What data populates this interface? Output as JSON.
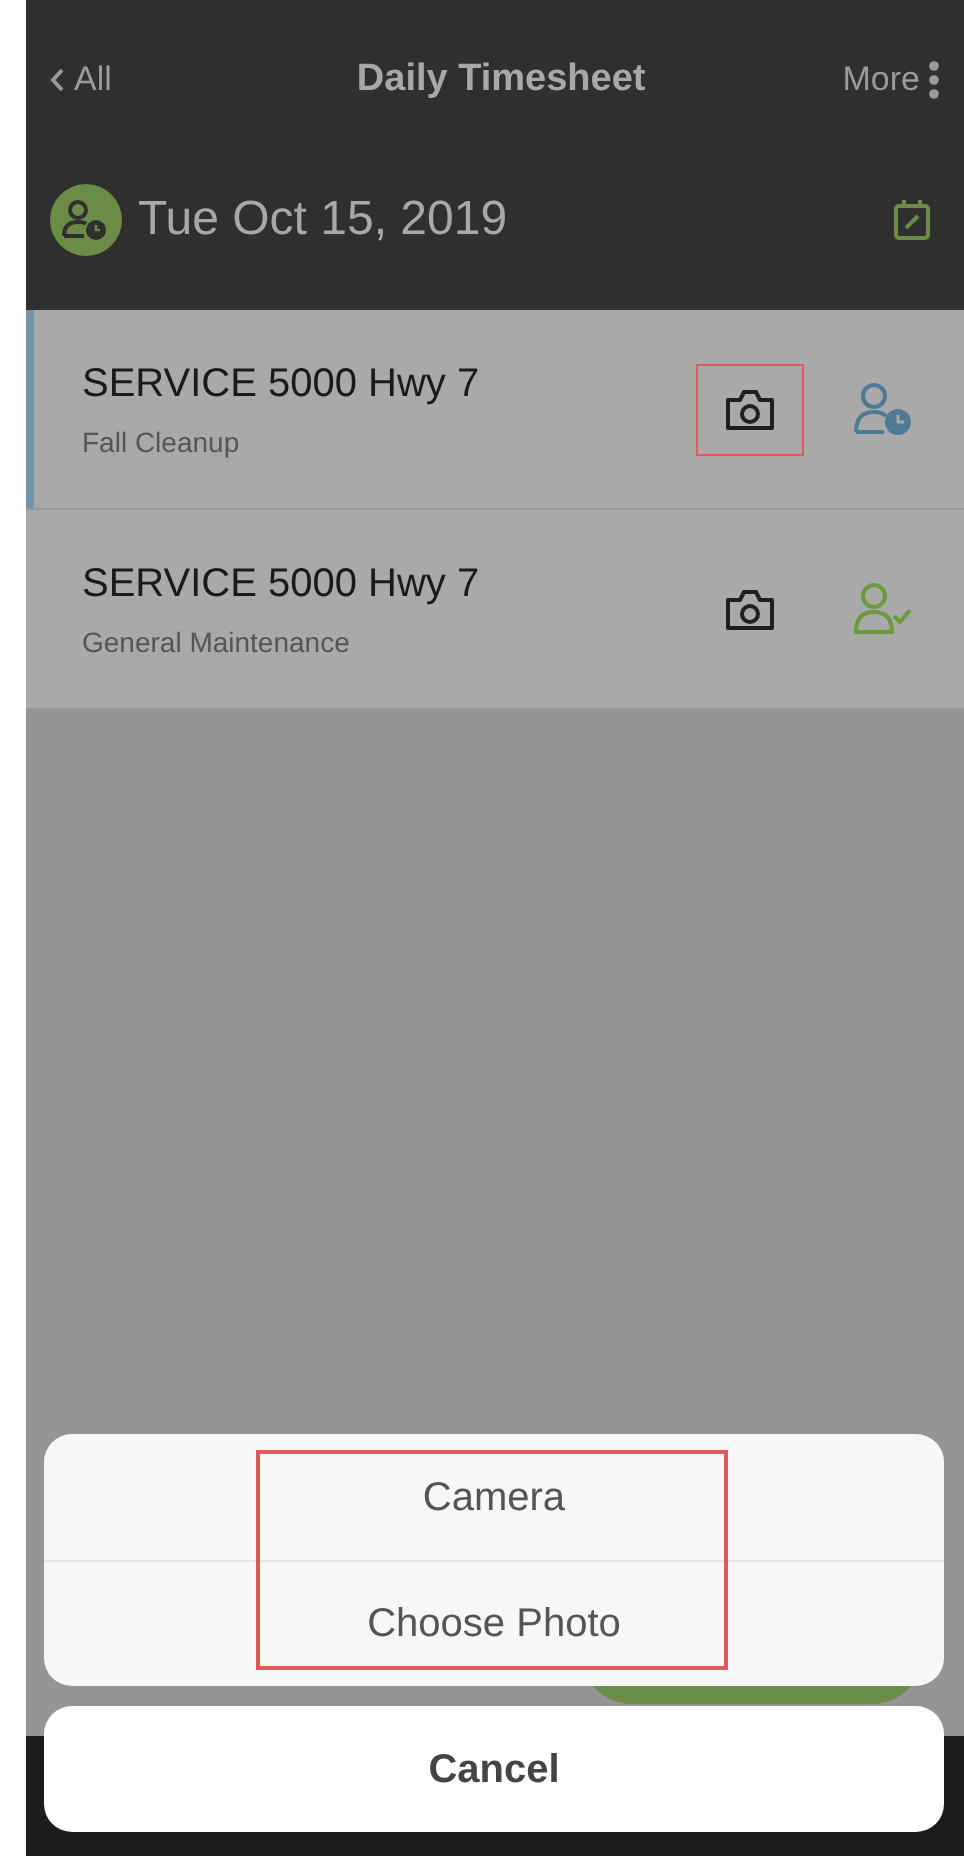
{
  "nav": {
    "back": "All",
    "title": "Daily Timesheet",
    "more": "More"
  },
  "date_bar": {
    "date": "Tue Oct 15, 2019"
  },
  "rows": [
    {
      "title": "SERVICE 5000 Hwy 7",
      "subtitle": "Fall Cleanup",
      "selected": true,
      "camera_highlighted": true,
      "kind": "clock"
    },
    {
      "title": "SERVICE 5000 Hwy 7",
      "subtitle": "General Maintenance",
      "selected": false,
      "camera_highlighted": false,
      "kind": "check"
    }
  ],
  "action_sheet": {
    "options": [
      "Camera",
      "Choose Photo"
    ],
    "highlighted": true,
    "cancel": "Cancel"
  }
}
